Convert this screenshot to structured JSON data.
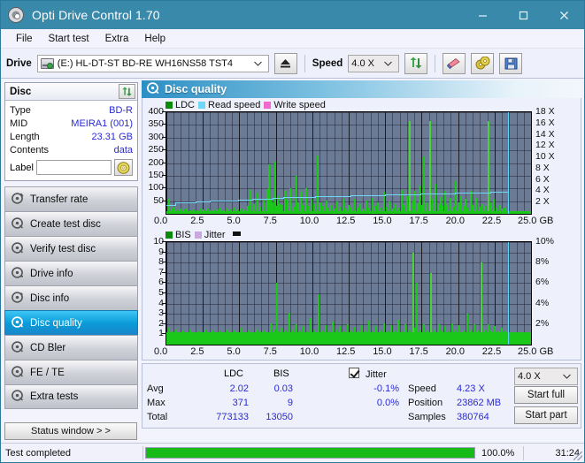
{
  "window": {
    "title": "Opti Drive Control 1.70",
    "icon": "disc-icon",
    "minimize": "–",
    "maximize": "□",
    "close": "✕"
  },
  "menu": {
    "items": [
      "File",
      "Start test",
      "Extra",
      "Help"
    ]
  },
  "toolbar": {
    "drive_label": "Drive",
    "drive_value": "(E:)  HL-DT-ST BD-RE  WH16NS58 TST4",
    "eject_icon": "eject-icon",
    "speed_label": "Speed",
    "speed_value": "4.0 X",
    "refresh_icon": "refresh-icon",
    "erase_icon": "eraser-icon",
    "discs_icon": "discs-icon",
    "save_icon": "save-icon",
    "chevron": "⌄"
  },
  "disc_panel": {
    "title": "Disc",
    "refresh_icon": "refresh-icon",
    "rows": [
      {
        "key": "Type",
        "value": "BD-R"
      },
      {
        "key": "MID",
        "value": "MEIRA1 (001)"
      },
      {
        "key": "Length",
        "value": "23.31 GB"
      },
      {
        "key": "Contents",
        "value": "data"
      }
    ],
    "label_key": "Label",
    "label_value": "",
    "label_icon": "cd-icon"
  },
  "sidebar": {
    "items": [
      {
        "label": "Transfer rate",
        "icon": "disc-icon",
        "active": false
      },
      {
        "label": "Create test disc",
        "icon": "disc-icon",
        "active": false
      },
      {
        "label": "Verify test disc",
        "icon": "disc-icon",
        "active": false
      },
      {
        "label": "Drive info",
        "icon": "disc-icon",
        "active": false
      },
      {
        "label": "Disc info",
        "icon": "disc-icon",
        "active": false
      },
      {
        "label": "Disc quality",
        "icon": "disc-icon",
        "active": true
      },
      {
        "label": "CD Bler",
        "icon": "disc-icon",
        "active": false
      },
      {
        "label": "FE / TE",
        "icon": "disc-icon",
        "active": false
      },
      {
        "label": "Extra tests",
        "icon": "disc-icon",
        "active": false
      }
    ],
    "status_window_button": "Status window > >"
  },
  "main": {
    "header_title": "Disc quality",
    "header_icon": "disc-quality-icon"
  },
  "stats": {
    "col_headers": [
      "LDC",
      "BIS"
    ],
    "rows": [
      {
        "label": "Avg",
        "ldc": "2.02",
        "bis": "0.03",
        "jitter": "-0.1%"
      },
      {
        "label": "Max",
        "ldc": "371",
        "bis": "9",
        "jitter": "0.0%"
      },
      {
        "label": "Total",
        "ldc": "773133",
        "bis": "13050",
        "jitter": ""
      }
    ],
    "jitter_label": "Jitter",
    "jitter_checked": true,
    "speed_label": "Speed",
    "speed_value": "4.23 X",
    "position_label": "Position",
    "position_value": "23862 MB",
    "samples_label": "Samples",
    "samples_value": "380764",
    "speed_select": "4.0 X",
    "start_full": "Start full",
    "start_part": "Start part"
  },
  "statusbar": {
    "message": "Test completed",
    "percent_label": "100.0%",
    "percent_value": 100,
    "elapsed": "31:24"
  },
  "colors": {
    "accent": "#3989ab",
    "ldc_green": "#19c819",
    "read_speed": "#6fd8f7",
    "write_speed": "#f06ad0",
    "jitter": "#c9a8e0",
    "plot_bg": "#6b7b96",
    "value_blue": "#2a2ad6",
    "progress_green": "#17bb17",
    "active_nav": "#0a9bd8"
  },
  "chart_data": [
    {
      "type": "bar",
      "id": "ldc-chart",
      "title": "",
      "legend": [
        {
          "name": "LDC",
          "color": "#19c819"
        },
        {
          "name": "Read speed",
          "color": "#6fd8f7"
        },
        {
          "name": "Write speed",
          "color": "#f06ad0"
        }
      ],
      "legend_position": "top-left",
      "xlabel": "GB",
      "ylabel": "LDC",
      "y2label": "Speed",
      "xlim": [
        0,
        25
      ],
      "ylim": [
        0,
        400
      ],
      "y2lim": [
        0,
        18
      ],
      "xticks": [
        0.0,
        2.5,
        5.0,
        7.5,
        10.0,
        12.5,
        15.0,
        17.5,
        20.0,
        22.5,
        25.0
      ],
      "xticklabels": [
        "0.0",
        "2.5",
        "5.0",
        "7.5",
        "10.0",
        "12.5",
        "15.0",
        "17.5",
        "20.0",
        "22.5",
        "25.0 GB"
      ],
      "yticks": [
        50,
        100,
        150,
        200,
        250,
        300,
        350,
        400
      ],
      "y2ticks": [
        2,
        4,
        6,
        8,
        10,
        12,
        14,
        16,
        18
      ],
      "y2ticklabels": [
        "2 X",
        "4 X",
        "6 X",
        "8 X",
        "10 X",
        "12 X",
        "14 X",
        "16 X",
        "18 X"
      ],
      "grid": true,
      "end_of_data_x": 23.4,
      "series": [
        {
          "name": "LDC",
          "color": "#19c819",
          "x": [
            0.12,
            0.3,
            0.5,
            0.72,
            0.95,
            1.15,
            1.35,
            1.6,
            1.85,
            2.05,
            2.3,
            2.5,
            2.75,
            2.95,
            3.2,
            3.45,
            3.65,
            3.9,
            4.1,
            4.35,
            4.6,
            4.8,
            5.05,
            5.3,
            5.5,
            5.7,
            5.95,
            6.2,
            6.4,
            6.6,
            6.85,
            7.0,
            7.1,
            7.25,
            7.4,
            7.5,
            7.6,
            7.7,
            7.85,
            8.05,
            8.25,
            8.45,
            8.65,
            8.85,
            9.0,
            9.15,
            9.3,
            9.5,
            9.7,
            9.9,
            10.1,
            10.3,
            10.5,
            10.7,
            10.9,
            11.05,
            11.25,
            11.45,
            11.65,
            11.85,
            12.05,
            12.25,
            12.45,
            12.65,
            12.85,
            13.05,
            13.25,
            13.45,
            13.65,
            13.85,
            14.05,
            14.25,
            14.45,
            14.65,
            14.85,
            15.05,
            15.25,
            15.45,
            15.65,
            15.85,
            16.05,
            16.25,
            16.45,
            16.65,
            16.85,
            17.0,
            17.15,
            17.3,
            17.45,
            17.6,
            17.8,
            18.0,
            18.2,
            18.4,
            18.6,
            18.75,
            18.9,
            19.05,
            19.2,
            19.4,
            19.6,
            19.8,
            20.0,
            20.15,
            20.3,
            20.45,
            20.6,
            20.8,
            21.0,
            21.2,
            21.4,
            21.6,
            21.8,
            22.0,
            22.2,
            22.4,
            22.6,
            22.8,
            23.0,
            23.2,
            23.35
          ],
          "y": [
            60,
            22,
            28,
            18,
            22,
            16,
            20,
            15,
            18,
            14,
            20,
            16,
            22,
            14,
            18,
            16,
            24,
            15,
            20,
            18,
            26,
            16,
            22,
            18,
            30,
            95,
            40,
            85,
            28,
            55,
            96,
            195,
            60,
            45,
            205,
            30,
            70,
            40,
            36,
            90,
            55,
            100,
            28,
            150,
            46,
            88,
            35,
            100,
            30,
            60,
            38,
            228,
            44,
            30,
            52,
            26,
            36,
            22,
            48,
            28,
            58,
            22,
            36,
            26,
            60,
            24,
            40,
            22,
            52,
            26,
            62,
            30,
            44,
            24,
            86,
            28,
            48,
            22,
            40,
            26,
            95,
            34,
            70,
            365,
            52,
            90,
            42,
            110,
            34,
            225,
            46,
            365,
            58,
            120,
            38,
            66,
            30,
            90,
            40,
            62,
            28,
            130,
            44,
            70,
            32,
            58,
            26,
            92,
            36,
            64,
            28,
            40,
            30,
            365,
            46,
            60,
            26,
            34,
            20,
            24,
            18
          ]
        },
        {
          "name": "Read speed",
          "color": "#6fd8f7",
          "x": [
            0.0,
            0.6,
            1.2,
            2.0,
            3.0,
            4.0,
            4.9,
            5.9,
            6.5,
            7.3,
            8.0,
            8.6,
            9.4,
            10.2,
            11.0,
            11.8,
            12.6,
            13.4,
            14.2,
            15.0,
            15.8,
            16.6,
            17.4,
            18.2,
            19.0,
            19.8,
            20.6,
            21.4,
            22.2,
            23.0,
            23.4
          ],
          "y": [
            1.6,
            2.0,
            2.1,
            2.2,
            2.3,
            2.4,
            2.5,
            2.6,
            2.7,
            2.8,
            2.9,
            3.0,
            3.05,
            3.1,
            3.15,
            3.2,
            3.25,
            3.3,
            3.35,
            3.4,
            3.45,
            3.5,
            3.55,
            3.6,
            3.65,
            3.7,
            3.75,
            3.8,
            3.85,
            3.95,
            4.0
          ]
        }
      ]
    },
    {
      "type": "bar",
      "id": "bis-chart",
      "title": "",
      "legend": [
        {
          "name": "BIS",
          "color": "#19c819"
        },
        {
          "name": "Jitter",
          "color": "#c9a8e0"
        }
      ],
      "legend_position": "top-left",
      "xlabel": "GB",
      "ylabel": "BIS",
      "y2label": "Jitter",
      "xlim": [
        0,
        25
      ],
      "ylim": [
        0,
        10
      ],
      "y2lim": [
        0,
        10
      ],
      "xticks": [
        0.0,
        2.5,
        5.0,
        7.5,
        10.0,
        12.5,
        15.0,
        17.5,
        20.0,
        22.5,
        25.0
      ],
      "xticklabels": [
        "0.0",
        "2.5",
        "5.0",
        "7.5",
        "10.0",
        "12.5",
        "15.0",
        "17.5",
        "20.0",
        "22.5",
        "25.0 GB"
      ],
      "yticks": [
        1,
        2,
        3,
        4,
        5,
        6,
        7,
        8,
        9,
        10
      ],
      "y2ticks": [
        2,
        4,
        6,
        8,
        10
      ],
      "y2ticklabels": [
        "2%",
        "4%",
        "6%",
        "8%",
        "10%"
      ],
      "grid": true,
      "end_of_data_x": 23.4,
      "series": [
        {
          "name": "BIS",
          "color": "#19c819",
          "x": [
            0.1,
            0.35,
            0.6,
            0.85,
            1.1,
            1.35,
            1.6,
            1.85,
            2.1,
            2.35,
            2.6,
            2.85,
            3.1,
            3.35,
            3.6,
            3.85,
            4.1,
            4.35,
            4.6,
            4.85,
            5.1,
            5.35,
            5.6,
            5.85,
            6.1,
            6.35,
            6.6,
            6.85,
            7.1,
            7.35,
            7.5,
            7.6,
            7.85,
            8.1,
            8.35,
            8.6,
            8.85,
            9.1,
            9.35,
            9.6,
            9.85,
            10.1,
            10.35,
            10.6,
            10.85,
            11.1,
            11.35,
            11.6,
            11.85,
            12.1,
            12.35,
            12.6,
            12.85,
            13.1,
            13.35,
            13.6,
            13.85,
            14.1,
            14.35,
            14.6,
            14.85,
            15.1,
            15.35,
            15.6,
            15.85,
            16.1,
            16.35,
            16.6,
            16.85,
            17.0,
            17.1,
            17.35,
            17.6,
            17.85,
            18.1,
            18.35,
            18.6,
            18.8,
            19.05,
            19.3,
            19.55,
            19.8,
            20.05,
            20.3,
            20.55,
            20.8,
            21.05,
            21.3,
            21.55,
            21.8,
            22.0,
            22.2,
            22.45,
            22.7,
            22.95,
            23.2,
            23.35
          ],
          "y": [
            1.6,
            1.3,
            1.5,
            1.2,
            1.4,
            1.2,
            1.5,
            1.2,
            1.3,
            1.2,
            1.5,
            1.2,
            1.4,
            1.2,
            1.3,
            1.2,
            1.5,
            1.2,
            1.4,
            1.2,
            1.6,
            1.2,
            1.4,
            1.2,
            1.5,
            1.3,
            1.4,
            1.2,
            2.1,
            1.5,
            6.0,
            1.3,
            1.6,
            1.4,
            3.1,
            1.5,
            2.0,
            1.4,
            1.8,
            1.3,
            2.6,
            1.5,
            4.9,
            1.4,
            1.9,
            1.3,
            2.2,
            1.5,
            1.8,
            1.3,
            2.0,
            1.4,
            1.7,
            1.3,
            1.9,
            1.4,
            2.3,
            1.3,
            1.8,
            1.4,
            2.1,
            1.3,
            1.9,
            1.4,
            2.4,
            1.3,
            2.0,
            1.5,
            9.0,
            1.6,
            6.0,
            1.5,
            2.0,
            1.4,
            7.0,
            1.5,
            2.0,
            1.4,
            1.8,
            1.3,
            2.1,
            1.5,
            1.9,
            1.4,
            3.0,
            1.5,
            2.0,
            1.4,
            8.0,
            1.5,
            2.0,
            1.4,
            1.8,
            1.3,
            1.6,
            1.4,
            1.3
          ]
        }
      ]
    }
  ]
}
